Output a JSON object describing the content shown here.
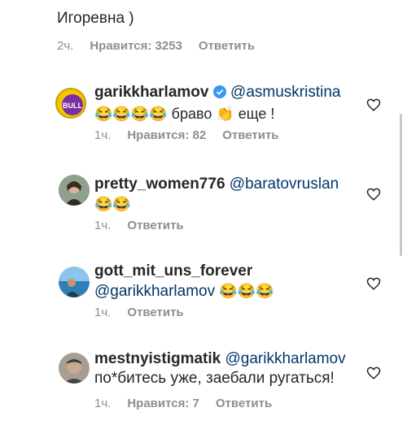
{
  "previous": {
    "text_tail": "Игоревна )",
    "time": "2ч.",
    "likes": "Нравится: 3253",
    "reply": "Ответить"
  },
  "comments": [
    {
      "username": "garikkharlamov",
      "verified": true,
      "mention": "@asmuskristina",
      "text": "😂😂😂😂 браво 👏 еще !",
      "time": "1ч.",
      "likes": "Нравится: 82",
      "reply": "Ответить",
      "avatar_icon": "bulldog-logo-avatar"
    },
    {
      "username": "pretty_women776",
      "mention": "@baratovruslan",
      "text": "😂😂",
      "time": "1ч.",
      "likes": "",
      "reply": "Ответить",
      "avatar_icon": "woman-avatar"
    },
    {
      "username": "gott_mit_uns_forever",
      "mention": "@garikkharlamov",
      "text": "😂😂😂",
      "time": "1ч.",
      "likes": "",
      "reply": "Ответить",
      "avatar_icon": "sea-avatar"
    },
    {
      "username": "mestnyistigmatik",
      "mention": "@garikkharlamov",
      "text": "по*битесь уже, заебали ругаться!",
      "time": "1ч.",
      "likes": "Нравится: 7",
      "reply": "Ответить",
      "avatar_icon": "man-avatar"
    }
  ],
  "colors": {
    "mention": "#00376b",
    "meta": "#8e8e8e",
    "verified": "#3897f0"
  }
}
